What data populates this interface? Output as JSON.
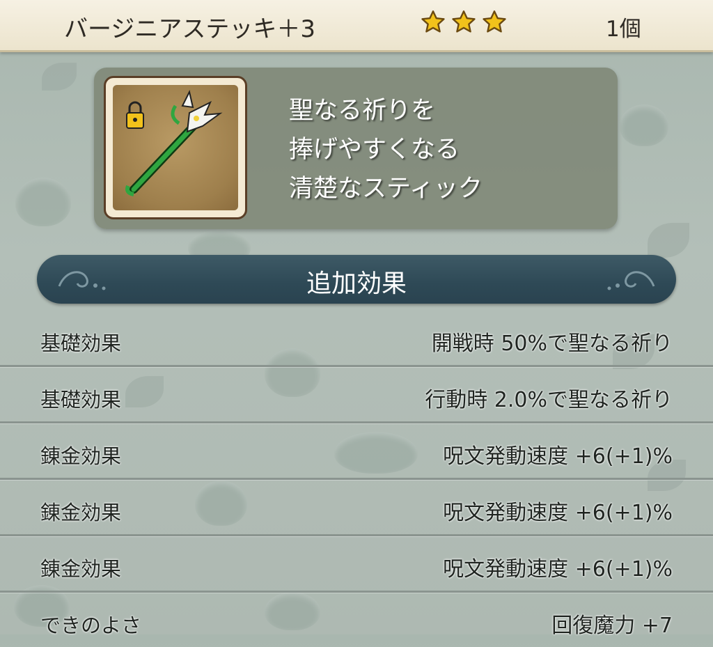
{
  "header": {
    "item_name": "バージニアステッキ＋3",
    "stars": 3,
    "count": "1個"
  },
  "card": {
    "icon": "lily-staff-with-lock-icon",
    "description_lines": [
      "聖なる祈りを",
      "捧げやすくなる",
      "清楚なスティック"
    ]
  },
  "section": {
    "title": "追加効果"
  },
  "effects": [
    {
      "label": "基礎効果",
      "value": "開戦時  50%で聖なる祈り"
    },
    {
      "label": "基礎効果",
      "value": "行動時  2.0%で聖なる祈り"
    },
    {
      "label": "錬金効果",
      "value": "呪文発動速度  +6(+1)%"
    },
    {
      "label": "錬金効果",
      "value": "呪文発動速度  +6(+1)%"
    },
    {
      "label": "錬金効果",
      "value": "呪文発動速度  +6(+1)%"
    },
    {
      "label": "できのよさ",
      "value": "回復魔力  +7"
    }
  ],
  "colors": {
    "header_bg": "#f3eddc",
    "star": "#f2c21b",
    "section_bar": "#2e4956",
    "card_bg": "#78806e"
  }
}
